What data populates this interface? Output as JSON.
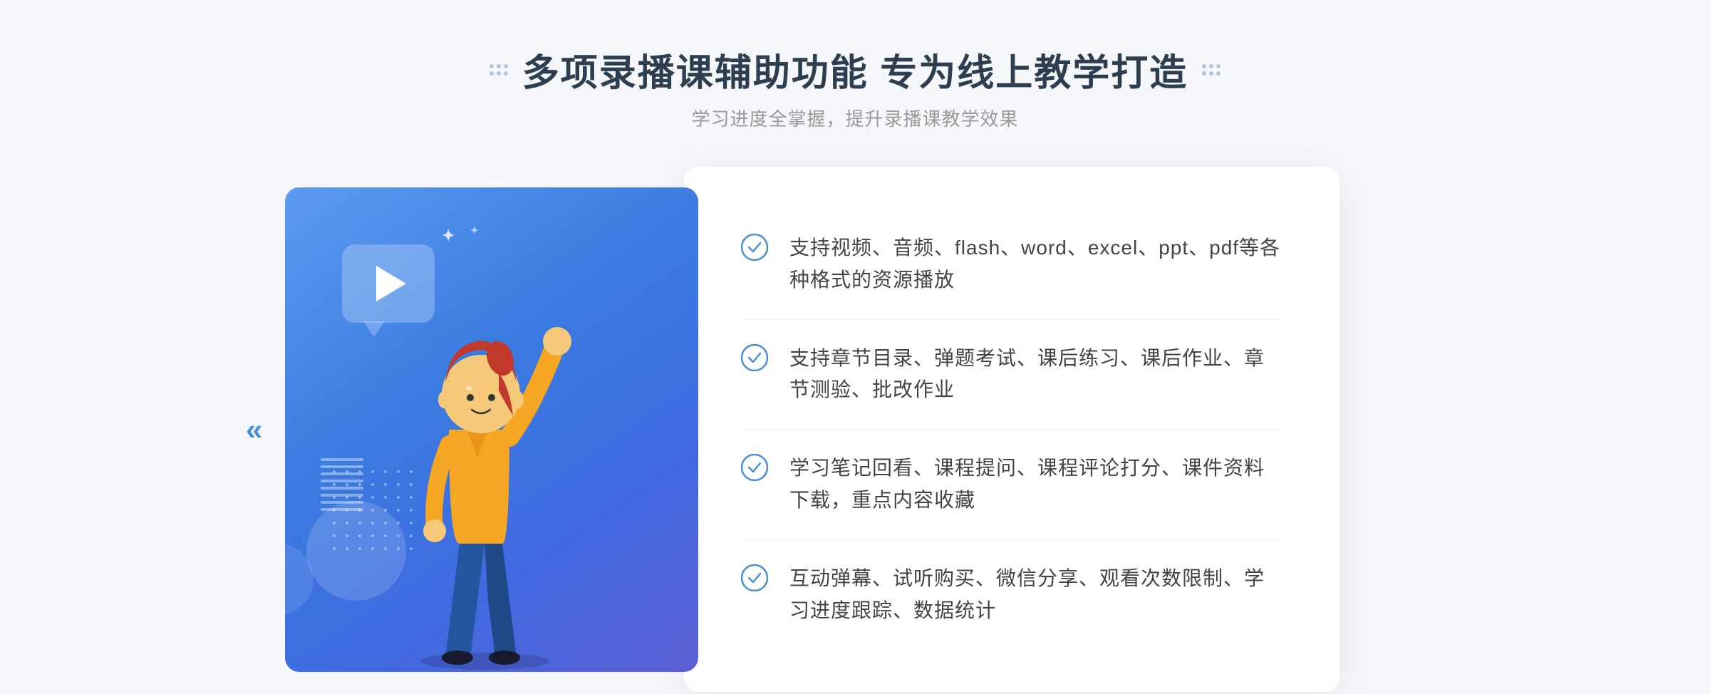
{
  "header": {
    "title": "多项录播课辅助功能 专为线上教学打造",
    "subtitle": "学习进度全掌握，提升录播课教学效果",
    "decorator_count": 6
  },
  "nav": {
    "arrow_left": "«"
  },
  "features": [
    {
      "id": 1,
      "text": "支持视频、音频、flash、word、excel、ppt、pdf等各种格式的资源播放"
    },
    {
      "id": 2,
      "text": "支持章节目录、弹题考试、课后练习、课后作业、章节测验、批改作业"
    },
    {
      "id": 3,
      "text": "学习笔记回看、课程提问、课程评论打分、课件资料下载，重点内容收藏"
    },
    {
      "id": 4,
      "text": "互动弹幕、试听购买、微信分享、观看次数限制、学习进度跟踪、数据统计"
    }
  ],
  "illustration": {
    "play_button": "▶",
    "spark_char": "·",
    "arrow_label": "»",
    "stripes": 8
  },
  "colors": {
    "accent_blue": "#4a7fe0",
    "check_circle": "#4a90d9",
    "text_dark": "#2c3e50",
    "text_gray": "#999999",
    "text_feature": "#444444",
    "bg": "#f5f7fa",
    "card_bg": "#ffffff"
  }
}
